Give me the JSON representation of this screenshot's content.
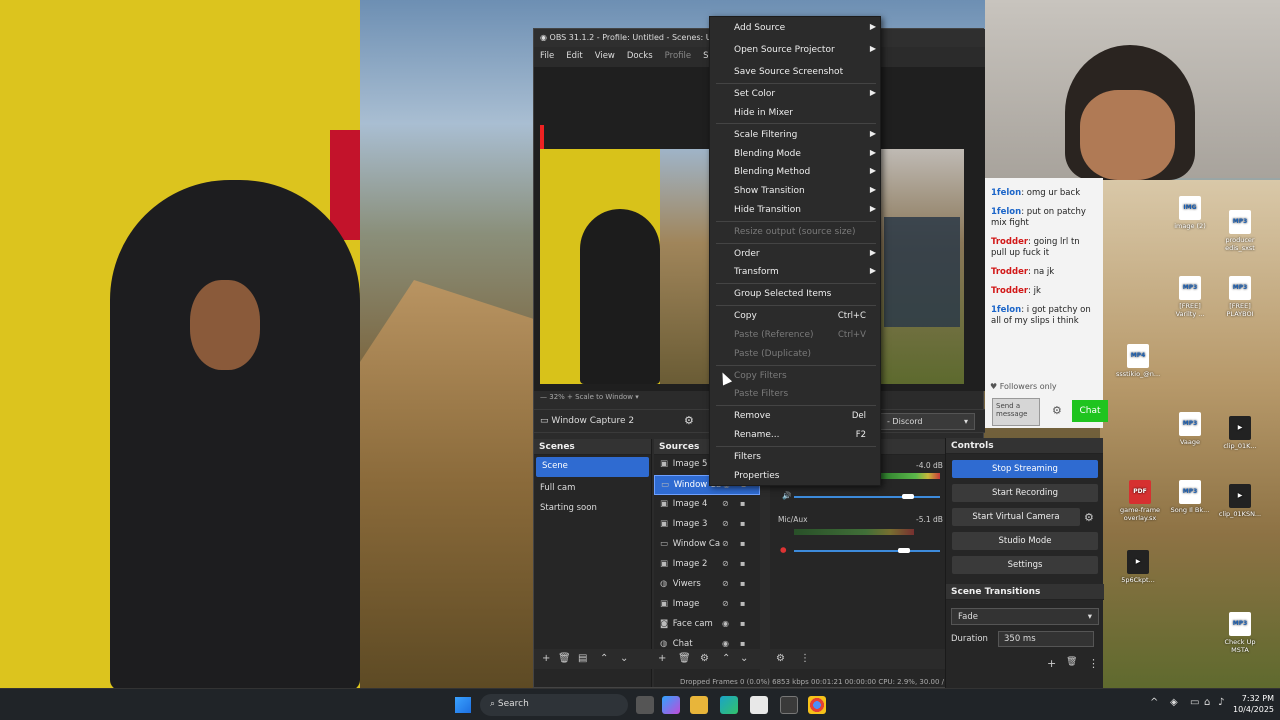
{
  "obs": {
    "title": "OBS 31.1.2 - Profile: Untitled - Scenes: Untitle",
    "menu": [
      "File",
      "Edit",
      "View",
      "Docks",
      "Profile",
      "Scene"
    ],
    "zoom": "32%",
    "scale_mode": "Scale to Window",
    "selected_source_name": "Window Capture 2",
    "window_select": "- Discord",
    "scenes_header": "Scenes",
    "scenes": [
      {
        "label": "Scene",
        "active": true
      },
      {
        "label": "Full cam",
        "active": false
      },
      {
        "label": "Starting soon",
        "active": false
      }
    ],
    "sources_header": "Sources",
    "sources": [
      {
        "label": "Image 5",
        "icon": "image-icon"
      },
      {
        "label": "Window Ca",
        "icon": "window-icon",
        "selected": true
      },
      {
        "label": "Image 4",
        "icon": "image-icon"
      },
      {
        "label": "Image 3",
        "icon": "image-icon"
      },
      {
        "label": "Window Ca",
        "icon": "window-icon"
      },
      {
        "label": "Image 2",
        "icon": "image-icon"
      },
      {
        "label": "Viwers",
        "icon": "browser-icon"
      },
      {
        "label": "Image",
        "icon": "image-icon"
      },
      {
        "label": "Face cam",
        "icon": "camera-icon"
      },
      {
        "label": "Chat",
        "icon": "browser-icon"
      }
    ],
    "mixer": {
      "track1_db": "-4.0 dB",
      "track2_label": "Mic/Aux",
      "track2_db": "-5.1 dB"
    },
    "status": {
      "dropped": "Dropped Frames 0 (0.0%)",
      "bitrate": "6853 kbps",
      "live": "00:01:21",
      "rec": "00:00:00",
      "cpu": "CPU: 2.9%, 30.00 / 30.00 FPS"
    }
  },
  "controls": {
    "header": "Controls",
    "stop_streaming": "Stop Streaming",
    "start_recording": "Start Recording",
    "start_virtual_camera": "Start Virtual Camera",
    "studio_mode": "Studio Mode",
    "settings": "Settings",
    "transitions_header": "Scene Transitions",
    "transition": "Fade",
    "duration_label": "Duration",
    "duration_value": "350 ms"
  },
  "context_menu": {
    "items": [
      {
        "label": "Add Source",
        "submenu": true
      },
      {
        "label": "Open Source Projector",
        "submenu": true
      },
      {
        "label": "Save Source Screenshot"
      },
      {
        "label": "Set Color",
        "submenu": true
      },
      {
        "label": "Hide in Mixer"
      },
      {
        "label": "Scale Filtering",
        "submenu": true
      },
      {
        "label": "Blending Mode",
        "submenu": true
      },
      {
        "label": "Blending Method",
        "submenu": true
      },
      {
        "label": "Show Transition",
        "submenu": true
      },
      {
        "label": "Hide Transition",
        "submenu": true
      },
      {
        "label": "Resize output (source size)",
        "disabled": true
      },
      {
        "label": "Order",
        "submenu": true
      },
      {
        "label": "Transform",
        "submenu": true
      },
      {
        "label": "Group Selected Items"
      },
      {
        "label": "Copy",
        "shortcut": "Ctrl+C"
      },
      {
        "label": "Paste (Reference)",
        "shortcut": "Ctrl+V",
        "disabled": true
      },
      {
        "label": "Paste (Duplicate)",
        "disabled": true
      },
      {
        "label": "Copy Filters",
        "disabled": true
      },
      {
        "label": "Paste Filters",
        "disabled": true
      },
      {
        "label": "Remove",
        "shortcut": "Del"
      },
      {
        "label": "Rename...",
        "shortcut": "F2"
      },
      {
        "label": "Filters"
      },
      {
        "label": "Properties"
      }
    ]
  },
  "chat": {
    "messages": [
      {
        "user": "1felon",
        "text": ": omg ur back",
        "color": "blue"
      },
      {
        "user": "1felon",
        "text": ": put on patchy mix fight",
        "color": "blue"
      },
      {
        "user": "Trodder",
        "text": ": going lrl tn pull up fuck it",
        "color": "red"
      },
      {
        "user": "Trodder",
        "text": ": na jk",
        "color": "red"
      },
      {
        "user": "Trodder",
        "text": ": jk",
        "color": "red"
      },
      {
        "user": "1felon",
        "text": ": i got patchy on all of my slips i think",
        "color": "blue"
      }
    ],
    "followers_only": "Followers only",
    "input_placeholder": "Send a message",
    "send_button": "Chat"
  },
  "desktop_icons": [
    {
      "label": "image (2)",
      "kind": "file"
    },
    {
      "label": "producer edis_sxst",
      "kind": "mp3"
    },
    {
      "label": "[FREE] Varilty ...",
      "kind": "mp3"
    },
    {
      "label": "[FREE] PLAYBOI",
      "kind": "mp3"
    },
    {
      "label": "ssstikio_@n...",
      "kind": "file"
    },
    {
      "label": "Vaage",
      "kind": "mp3"
    },
    {
      "label": "clip_01K...",
      "kind": "dark"
    },
    {
      "label": "game-frame overlay.sx",
      "kind": "pdf"
    },
    {
      "label": "Song Il Bk...",
      "kind": "mp3"
    },
    {
      "label": "clip_01KSN...",
      "kind": "dark"
    },
    {
      "label": "5p6Ckpt...",
      "kind": "dark"
    },
    {
      "label": "Check Up MSTA",
      "kind": "mp3"
    }
  ],
  "taskbar": {
    "search": "Search",
    "time": "7:32 PM",
    "date": "10/4/2025"
  }
}
